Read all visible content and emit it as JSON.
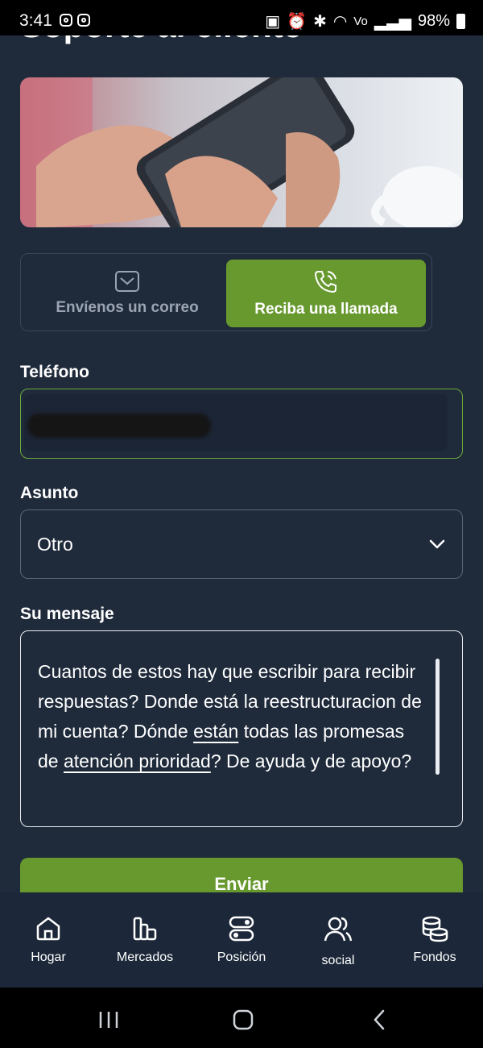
{
  "status_bar": {
    "time": "3:41",
    "wifi_label": "Vo\nWiFi",
    "battery": "98%"
  },
  "page": {
    "title": "Soporte al cliente"
  },
  "contact_tabs": [
    {
      "label": "Envíenos un correo",
      "icon": "mail-icon",
      "active": false
    },
    {
      "label": "Reciba una llamada",
      "icon": "phone-call-icon",
      "active": true
    }
  ],
  "form": {
    "phone_label": "Teléfono",
    "phone_value": "",
    "subject_label": "Asunto",
    "subject_value": "Otro",
    "message_label": "Su mensaje",
    "message_parts": [
      "Cuantos de estos hay que escribir para recibir respuestas? Donde está la reestructuracion de mi cuenta?  Dónde ",
      "están",
      " todas las promesas de ",
      "atención prioridad",
      "? De ayuda y de apoyo?"
    ],
    "submit_label": "Enviar"
  },
  "bottom_nav": [
    {
      "label": "Hogar",
      "icon": "home-icon"
    },
    {
      "label": "Mercados",
      "icon": "bar-chart-icon"
    },
    {
      "label": "Posición",
      "icon": "toggle-icon"
    },
    {
      "label": "social",
      "icon": "users-icon"
    },
    {
      "label": "Fondos",
      "icon": "coins-icon"
    }
  ],
  "colors": {
    "background": "#1f2a3b",
    "accent": "#67992f",
    "nav_background": "#1c2839"
  }
}
